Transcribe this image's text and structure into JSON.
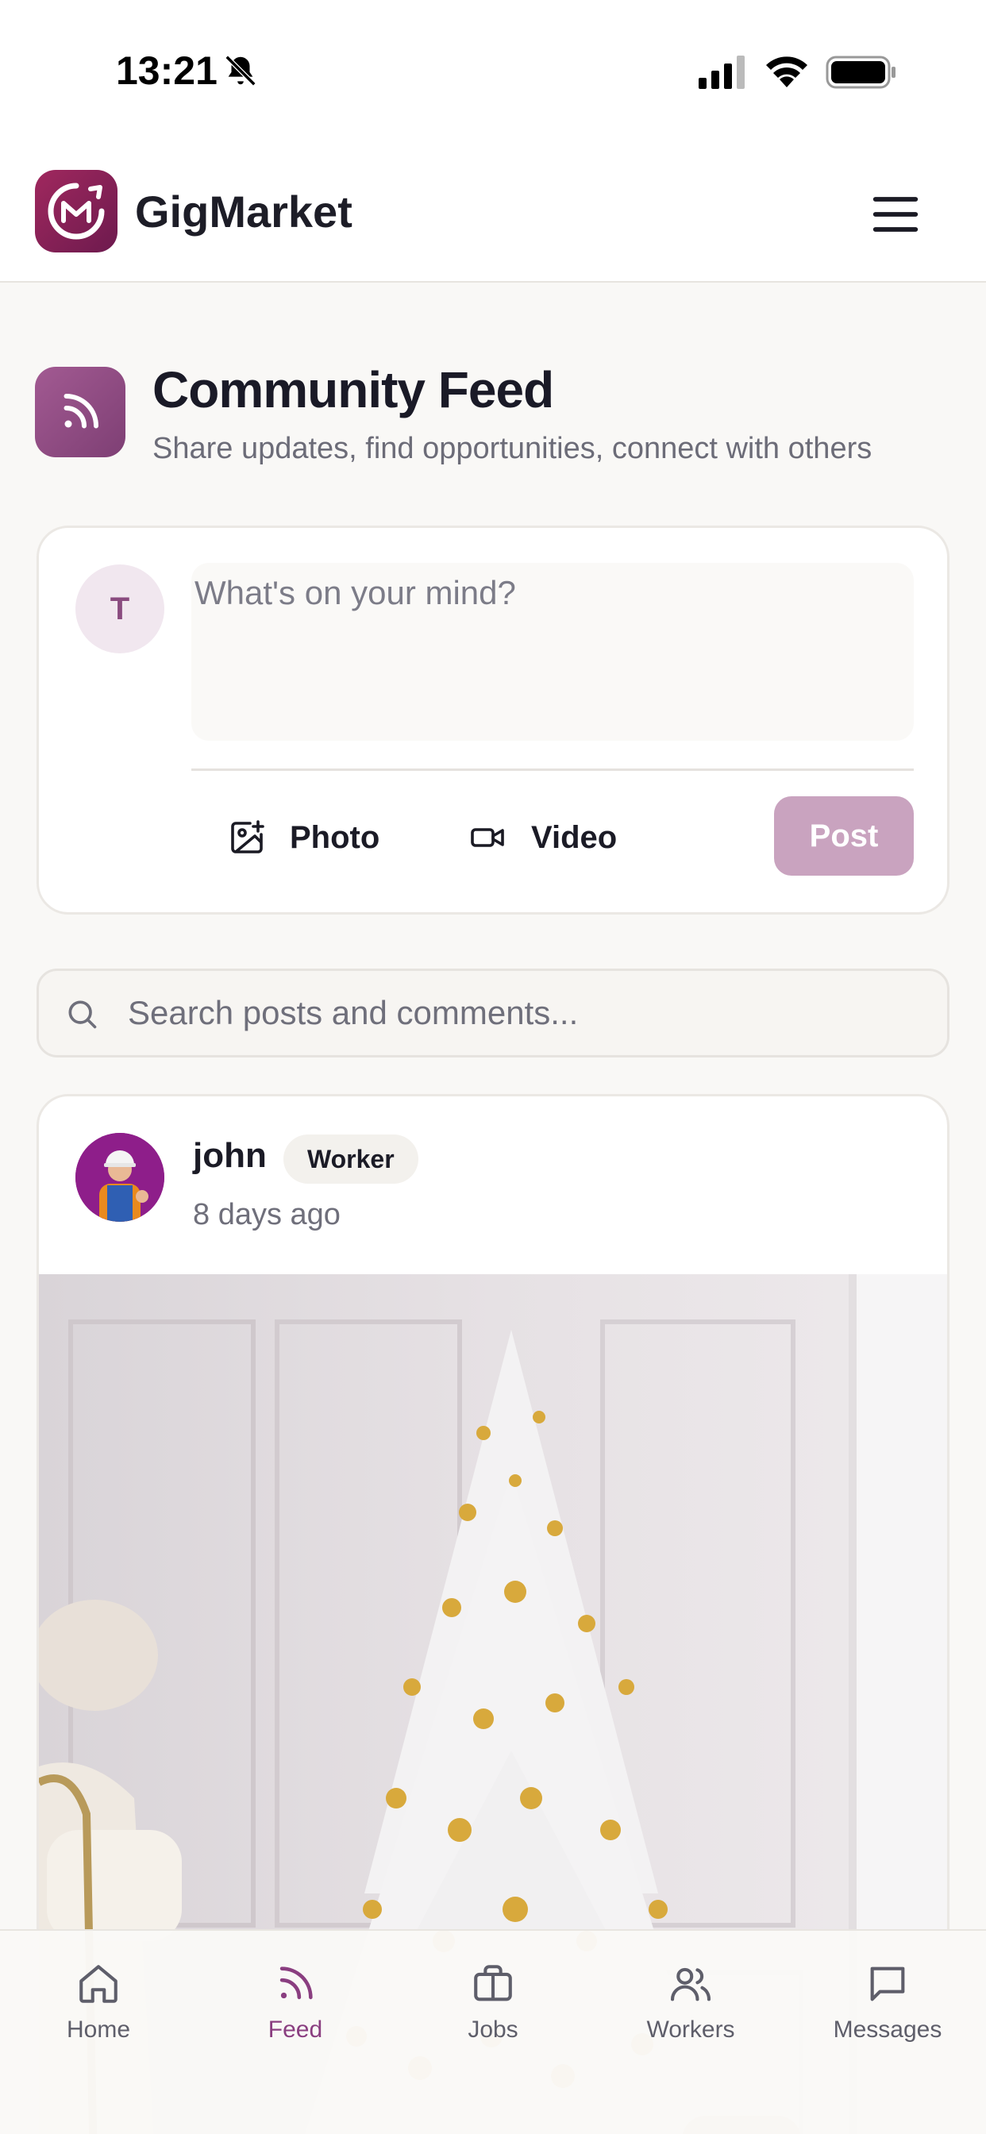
{
  "status_bar": {
    "time": "13:21"
  },
  "header": {
    "app_name": "GigMarket",
    "logo_letters": "GM"
  },
  "page": {
    "title": "Community Feed",
    "subtitle": "Share updates, find opportunities, connect with others"
  },
  "composer": {
    "avatar_initial": "T",
    "placeholder": "What's on your mind?",
    "photo_label": "Photo",
    "video_label": "Video",
    "post_label": "Post"
  },
  "search": {
    "placeholder": "Search posts and comments..."
  },
  "post": {
    "author": "john",
    "role": "Worker",
    "time": "8 days ago"
  },
  "bottom_nav": {
    "items": [
      {
        "label": "Home",
        "icon": "home-icon"
      },
      {
        "label": "Feed",
        "icon": "rss-icon",
        "active": true
      },
      {
        "label": "Jobs",
        "icon": "briefcase-icon"
      },
      {
        "label": "Workers",
        "icon": "users-icon"
      },
      {
        "label": "Messages",
        "icon": "message-icon"
      }
    ]
  },
  "colors": {
    "brand": "#8a3e80",
    "brand_dark": "#7a1f56",
    "post_button_disabled": "#c9a3bf",
    "background": "#f9f8f6"
  }
}
